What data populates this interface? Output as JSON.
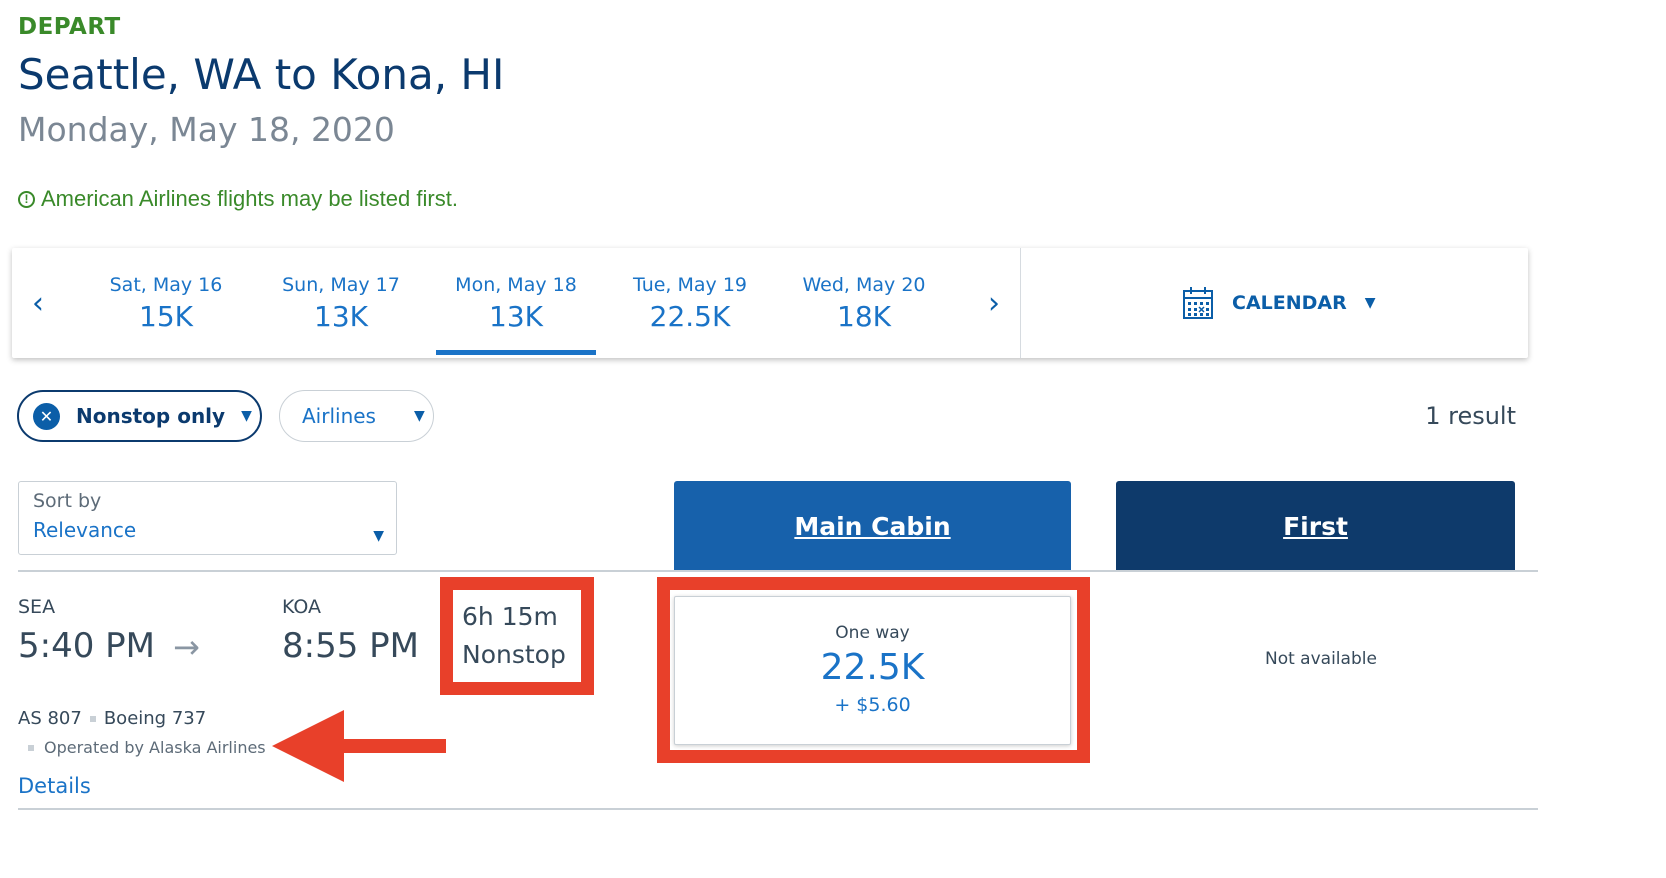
{
  "header": {
    "depart_label": "DEPART",
    "route": "Seattle, WA to Kona, HI",
    "date": "Monday, May 18, 2020"
  },
  "notice": {
    "icon": "exclamation-circle-icon",
    "text": "American Airlines flights may be listed first."
  },
  "datebar": {
    "prev_icon": "‹",
    "next_icon": "›",
    "days": [
      {
        "label": "Sat, May 16",
        "price": "15K"
      },
      {
        "label": "Sun, May 17",
        "price": "13K"
      },
      {
        "label": "Mon, May 18",
        "price": "13K",
        "active": true
      },
      {
        "label": "Tue, May 19",
        "price": "22.5K"
      },
      {
        "label": "Wed, May 20",
        "price": "18K"
      }
    ],
    "calendar_label": "CALENDAR"
  },
  "filters": {
    "nonstop_label": "Nonstop only",
    "airlines_label": "Airlines",
    "result_count": "1 result"
  },
  "sort": {
    "label": "Sort by",
    "value": "Relevance"
  },
  "cabins": {
    "main": "Main Cabin",
    "first": "First"
  },
  "flight": {
    "origin_code": "SEA",
    "depart_time": "5:40 PM",
    "dest_code": "KOA",
    "arrive_time": "8:55 PM",
    "arrow": "→",
    "duration": "6h 15m",
    "stops": "Nonstop",
    "flight_number": "AS 807",
    "aircraft": "Boeing 737",
    "operated_by": "Operated by Alaska Airlines",
    "details_label": "Details"
  },
  "fares": {
    "main": {
      "label": "One way",
      "price": "22.5K",
      "fee": "+ $5.60"
    },
    "first": {
      "status": "Not available"
    }
  },
  "colors": {
    "depart_green": "#3a8a2a",
    "title_navy": "#0b3a6e",
    "link_blue": "#1a73c7",
    "main_cabin_blue": "#1761ab",
    "first_cabin_navy": "#0e3a6b",
    "annotation_red": "#e8402a"
  }
}
